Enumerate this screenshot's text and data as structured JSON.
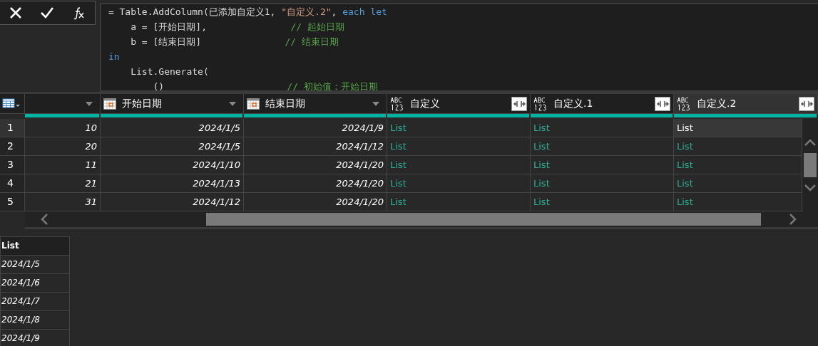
{
  "formula_bar": {
    "buttons": [
      {
        "kind": "cancel"
      },
      {
        "kind": "confirm"
      },
      {
        "kind": "fx"
      }
    ],
    "code_lines": [
      {
        "tokens": [
          {
            "kind": "plain",
            "text": "= Table.AddColumn(已添加自定义1, "
          },
          {
            "kind": "string",
            "text": "\"自定义.2\""
          },
          {
            "kind": "plain",
            "text": ", "
          },
          {
            "kind": "keyword",
            "text": "each let"
          }
        ]
      },
      {
        "tokens": [
          {
            "kind": "plain",
            "text": "    a = [开始日期],               "
          },
          {
            "kind": "comment",
            "text": "// 起始日期"
          }
        ]
      },
      {
        "tokens": [
          {
            "kind": "plain",
            "text": "    b = [结束日期]               "
          },
          {
            "kind": "comment",
            "text": "// 结束日期"
          }
        ]
      },
      {
        "tokens": [
          {
            "kind": "keyword",
            "text": "in"
          }
        ]
      },
      {
        "tokens": [
          {
            "kind": "plain",
            "text": "    List.Generate("
          }
        ]
      },
      {
        "tokens": [
          {
            "kind": "plain",
            "text": "        ()                      "
          },
          {
            "kind": "comment",
            "text": "// 初始值：开始日期"
          }
        ]
      }
    ]
  },
  "table": {
    "columns": [
      {
        "kind": "any"
      },
      {
        "kind": "date",
        "label": "开始日期"
      },
      {
        "kind": "date",
        "label": "结束日期"
      },
      {
        "kind": "list",
        "label": "自定义"
      },
      {
        "kind": "list",
        "label": "自定义.1"
      },
      {
        "kind": "list",
        "label": "自定义.2"
      }
    ],
    "rows": [
      {
        "number": "1",
        "cells": [
          {
            "text": "10",
            "selected": false
          },
          {
            "text": "2024/1/5",
            "selected": false
          },
          {
            "text": "2024/1/9",
            "selected": false
          },
          {
            "text": "List",
            "selected": false
          },
          {
            "text": "List",
            "selected": false
          },
          {
            "text": "List",
            "selected": true
          }
        ]
      },
      {
        "number": "2",
        "cells": [
          {
            "text": "20",
            "selected": false
          },
          {
            "text": "2024/1/5",
            "selected": false
          },
          {
            "text": "2024/1/12",
            "selected": false
          },
          {
            "text": "List",
            "selected": false
          },
          {
            "text": "List",
            "selected": false
          },
          {
            "text": "List",
            "selected": false
          }
        ]
      },
      {
        "number": "3",
        "cells": [
          {
            "text": "11",
            "selected": false
          },
          {
            "text": "2024/1/10",
            "selected": false
          },
          {
            "text": "2024/1/20",
            "selected": false
          },
          {
            "text": "List",
            "selected": false
          },
          {
            "text": "List",
            "selected": false
          },
          {
            "text": "List",
            "selected": false
          }
        ]
      },
      {
        "number": "4",
        "cells": [
          {
            "text": "21",
            "selected": false
          },
          {
            "text": "2024/1/13",
            "selected": false
          },
          {
            "text": "2024/1/20",
            "selected": false
          },
          {
            "text": "List",
            "selected": false
          },
          {
            "text": "List",
            "selected": false
          },
          {
            "text": "List",
            "selected": false
          }
        ]
      },
      {
        "number": "5",
        "cells": [
          {
            "text": "31",
            "selected": false
          },
          {
            "text": "2024/1/12",
            "selected": false
          },
          {
            "text": "2024/1/20",
            "selected": false
          },
          {
            "text": "List",
            "selected": false
          },
          {
            "text": "List",
            "selected": false
          },
          {
            "text": "List",
            "selected": false
          }
        ]
      }
    ]
  },
  "preview": {
    "header": "List",
    "items": [
      "2024/1/5",
      "2024/1/6",
      "2024/1/7",
      "2024/1/8",
      "2024/1/9"
    ]
  }
}
